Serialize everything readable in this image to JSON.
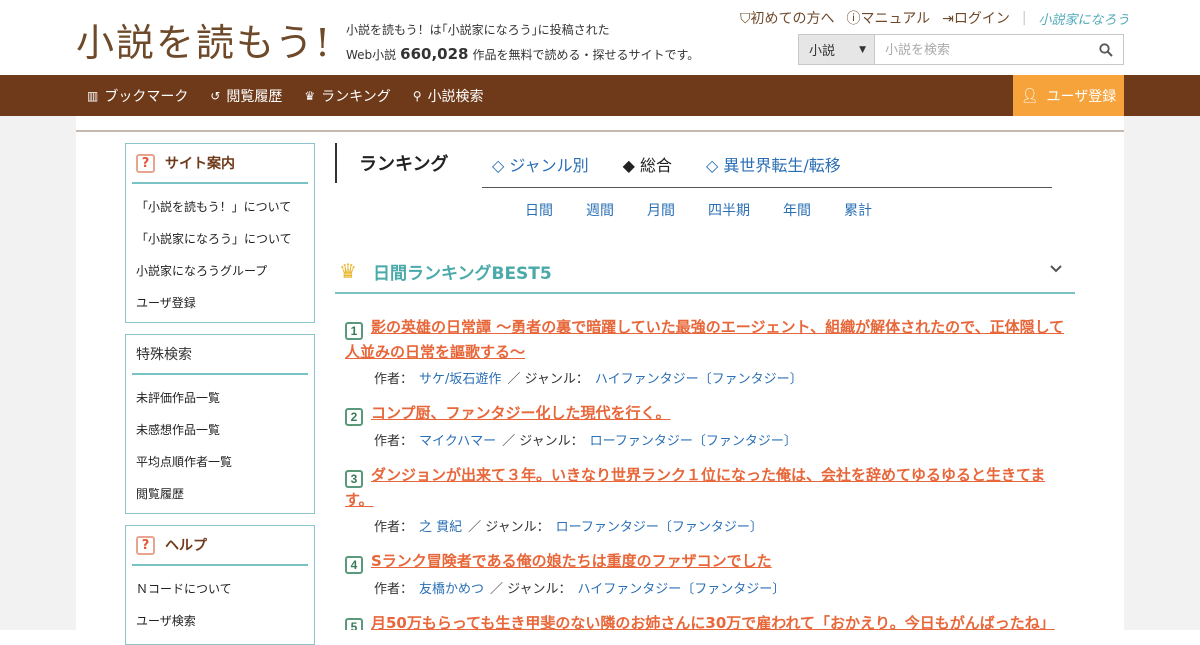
{
  "header": {
    "logo": "小説を読もう!",
    "tagline_line1": "小説を読もう！は｢小説家になろう｣に投稿された",
    "tagline_prefix": "Web小説",
    "tagline_count": "660,028",
    "tagline_suffix": "作品を無料で読める・探せるサイトです。",
    "links": [
      "初めての方へ",
      "マニュアル",
      "ログイン"
    ],
    "brand_link": "小説家になろう",
    "search": {
      "category": "小説",
      "placeholder": "小説を検索"
    }
  },
  "nav": {
    "items": [
      {
        "icon": "bookshelf-icon",
        "label": "ブックマーク"
      },
      {
        "icon": "history-icon",
        "label": "閲覧履歴"
      },
      {
        "icon": "crown-icon",
        "label": "ランキング"
      },
      {
        "icon": "search-icon",
        "label": "小説検索"
      }
    ],
    "register": "ユーザ登録"
  },
  "sidebar": {
    "site_guide": {
      "title": "サイト案内",
      "items": [
        "「小説を読もう！」について",
        "「小説家になろう」について",
        "小説家になろうグループ",
        "ユーザ登録"
      ]
    },
    "special_search": {
      "title": "特殊検索",
      "items": [
        "未評価作品一覧",
        "未感想作品一覧",
        "平均点順作者一覧",
        "閲覧履歴"
      ]
    },
    "help": {
      "title": "ヘルプ",
      "items": [
        "Ｎコードについて",
        "ユーザ検索"
      ]
    }
  },
  "ranking": {
    "title": "ランキング",
    "tabs": [
      "◇ ジャンル別",
      "◆ 総合",
      "◇ 異世界転生/転移"
    ],
    "periods": [
      "日間",
      "週間",
      "月間",
      "四半期",
      "年間",
      "累計"
    ],
    "best_title": "日間ランキングBEST5",
    "author_label": "作者：",
    "genre_label": "／ ジャンル：",
    "entries": [
      {
        "rank": "1",
        "title": "影の英雄の日常譚 ～勇者の裏で暗躍していた最強のエージェント、組織が解体されたので、正体隠して人並みの日常を謳歌する～",
        "author": "サケ/坂石遊作",
        "genre": "ハイファンタジー〔ファンタジー〕"
      },
      {
        "rank": "2",
        "title": "コンプ厨、ファンタジー化した現代を行く。",
        "author": "マイクハマー",
        "genre": "ローファンタジー〔ファンタジー〕"
      },
      {
        "rank": "3",
        "title": "ダンジョンが出来て３年。いきなり世界ランク１位になった俺は、会社を辞めてゆるゆると生きてます。",
        "author": "之 貫紀",
        "genre": "ローファンタジー〔ファンタジー〕"
      },
      {
        "rank": "4",
        "title": "Sランク冒険者である俺の娘たちは重度のファザコンでした",
        "author": "友橋かめつ",
        "genre": "ハイファンタジー〔ファンタジー〕"
      },
      {
        "rank": "5",
        "title": "月50万もらっても生き甲斐のない隣のお姉さんに30万で雇われて「おかえり。今日もがんばったね」"
      }
    ]
  }
}
